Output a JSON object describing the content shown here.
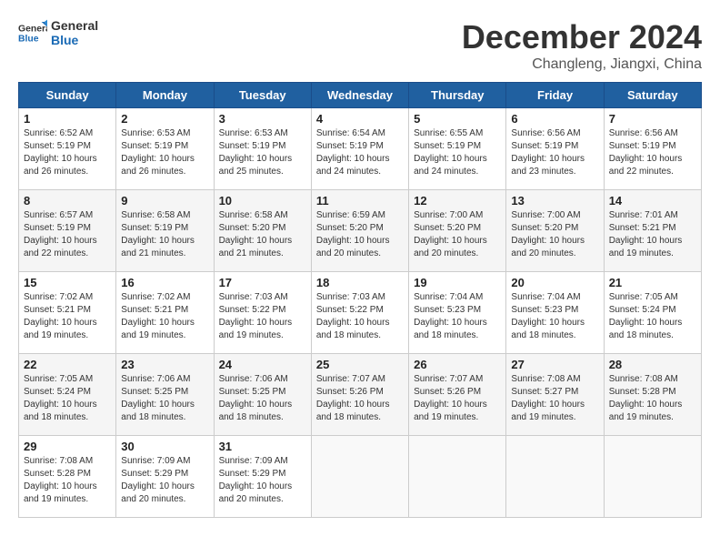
{
  "header": {
    "logo": {
      "general": "General",
      "blue": "Blue"
    },
    "title": "December 2024",
    "location": "Changleng, Jiangxi, China"
  },
  "calendar": {
    "days_of_week": [
      "Sunday",
      "Monday",
      "Tuesday",
      "Wednesday",
      "Thursday",
      "Friday",
      "Saturday"
    ],
    "weeks": [
      [
        null,
        {
          "day": 2,
          "sunrise": "6:53 AM",
          "sunset": "5:19 PM",
          "daylight": "10 hours and 26 minutes."
        },
        {
          "day": 3,
          "sunrise": "6:53 AM",
          "sunset": "5:19 PM",
          "daylight": "10 hours and 25 minutes."
        },
        {
          "day": 4,
          "sunrise": "6:54 AM",
          "sunset": "5:19 PM",
          "daylight": "10 hours and 24 minutes."
        },
        {
          "day": 5,
          "sunrise": "6:55 AM",
          "sunset": "5:19 PM",
          "daylight": "10 hours and 24 minutes."
        },
        {
          "day": 6,
          "sunrise": "6:56 AM",
          "sunset": "5:19 PM",
          "daylight": "10 hours and 23 minutes."
        },
        {
          "day": 7,
          "sunrise": "6:56 AM",
          "sunset": "5:19 PM",
          "daylight": "10 hours and 22 minutes."
        }
      ],
      [
        {
          "day": 8,
          "sunrise": "6:57 AM",
          "sunset": "5:19 PM",
          "daylight": "10 hours and 22 minutes."
        },
        {
          "day": 9,
          "sunrise": "6:58 AM",
          "sunset": "5:19 PM",
          "daylight": "10 hours and 21 minutes."
        },
        {
          "day": 10,
          "sunrise": "6:58 AM",
          "sunset": "5:20 PM",
          "daylight": "10 hours and 21 minutes."
        },
        {
          "day": 11,
          "sunrise": "6:59 AM",
          "sunset": "5:20 PM",
          "daylight": "10 hours and 20 minutes."
        },
        {
          "day": 12,
          "sunrise": "7:00 AM",
          "sunset": "5:20 PM",
          "daylight": "10 hours and 20 minutes."
        },
        {
          "day": 13,
          "sunrise": "7:00 AM",
          "sunset": "5:20 PM",
          "daylight": "10 hours and 20 minutes."
        },
        {
          "day": 14,
          "sunrise": "7:01 AM",
          "sunset": "5:21 PM",
          "daylight": "10 hours and 19 minutes."
        }
      ],
      [
        {
          "day": 15,
          "sunrise": "7:02 AM",
          "sunset": "5:21 PM",
          "daylight": "10 hours and 19 minutes."
        },
        {
          "day": 16,
          "sunrise": "7:02 AM",
          "sunset": "5:21 PM",
          "daylight": "10 hours and 19 minutes."
        },
        {
          "day": 17,
          "sunrise": "7:03 AM",
          "sunset": "5:22 PM",
          "daylight": "10 hours and 19 minutes."
        },
        {
          "day": 18,
          "sunrise": "7:03 AM",
          "sunset": "5:22 PM",
          "daylight": "10 hours and 18 minutes."
        },
        {
          "day": 19,
          "sunrise": "7:04 AM",
          "sunset": "5:23 PM",
          "daylight": "10 hours and 18 minutes."
        },
        {
          "day": 20,
          "sunrise": "7:04 AM",
          "sunset": "5:23 PM",
          "daylight": "10 hours and 18 minutes."
        },
        {
          "day": 21,
          "sunrise": "7:05 AM",
          "sunset": "5:24 PM",
          "daylight": "10 hours and 18 minutes."
        }
      ],
      [
        {
          "day": 22,
          "sunrise": "7:05 AM",
          "sunset": "5:24 PM",
          "daylight": "10 hours and 18 minutes."
        },
        {
          "day": 23,
          "sunrise": "7:06 AM",
          "sunset": "5:25 PM",
          "daylight": "10 hours and 18 minutes."
        },
        {
          "day": 24,
          "sunrise": "7:06 AM",
          "sunset": "5:25 PM",
          "daylight": "10 hours and 18 minutes."
        },
        {
          "day": 25,
          "sunrise": "7:07 AM",
          "sunset": "5:26 PM",
          "daylight": "10 hours and 18 minutes."
        },
        {
          "day": 26,
          "sunrise": "7:07 AM",
          "sunset": "5:26 PM",
          "daylight": "10 hours and 19 minutes."
        },
        {
          "day": 27,
          "sunrise": "7:08 AM",
          "sunset": "5:27 PM",
          "daylight": "10 hours and 19 minutes."
        },
        {
          "day": 28,
          "sunrise": "7:08 AM",
          "sunset": "5:28 PM",
          "daylight": "10 hours and 19 minutes."
        }
      ],
      [
        {
          "day": 29,
          "sunrise": "7:08 AM",
          "sunset": "5:28 PM",
          "daylight": "10 hours and 19 minutes."
        },
        {
          "day": 30,
          "sunrise": "7:09 AM",
          "sunset": "5:29 PM",
          "daylight": "10 hours and 20 minutes."
        },
        {
          "day": 31,
          "sunrise": "7:09 AM",
          "sunset": "5:29 PM",
          "daylight": "10 hours and 20 minutes."
        },
        null,
        null,
        null,
        null
      ]
    ],
    "week1_day1": {
      "day": 1,
      "sunrise": "6:52 AM",
      "sunset": "5:19 PM",
      "daylight": "10 hours and 26 minutes."
    }
  }
}
